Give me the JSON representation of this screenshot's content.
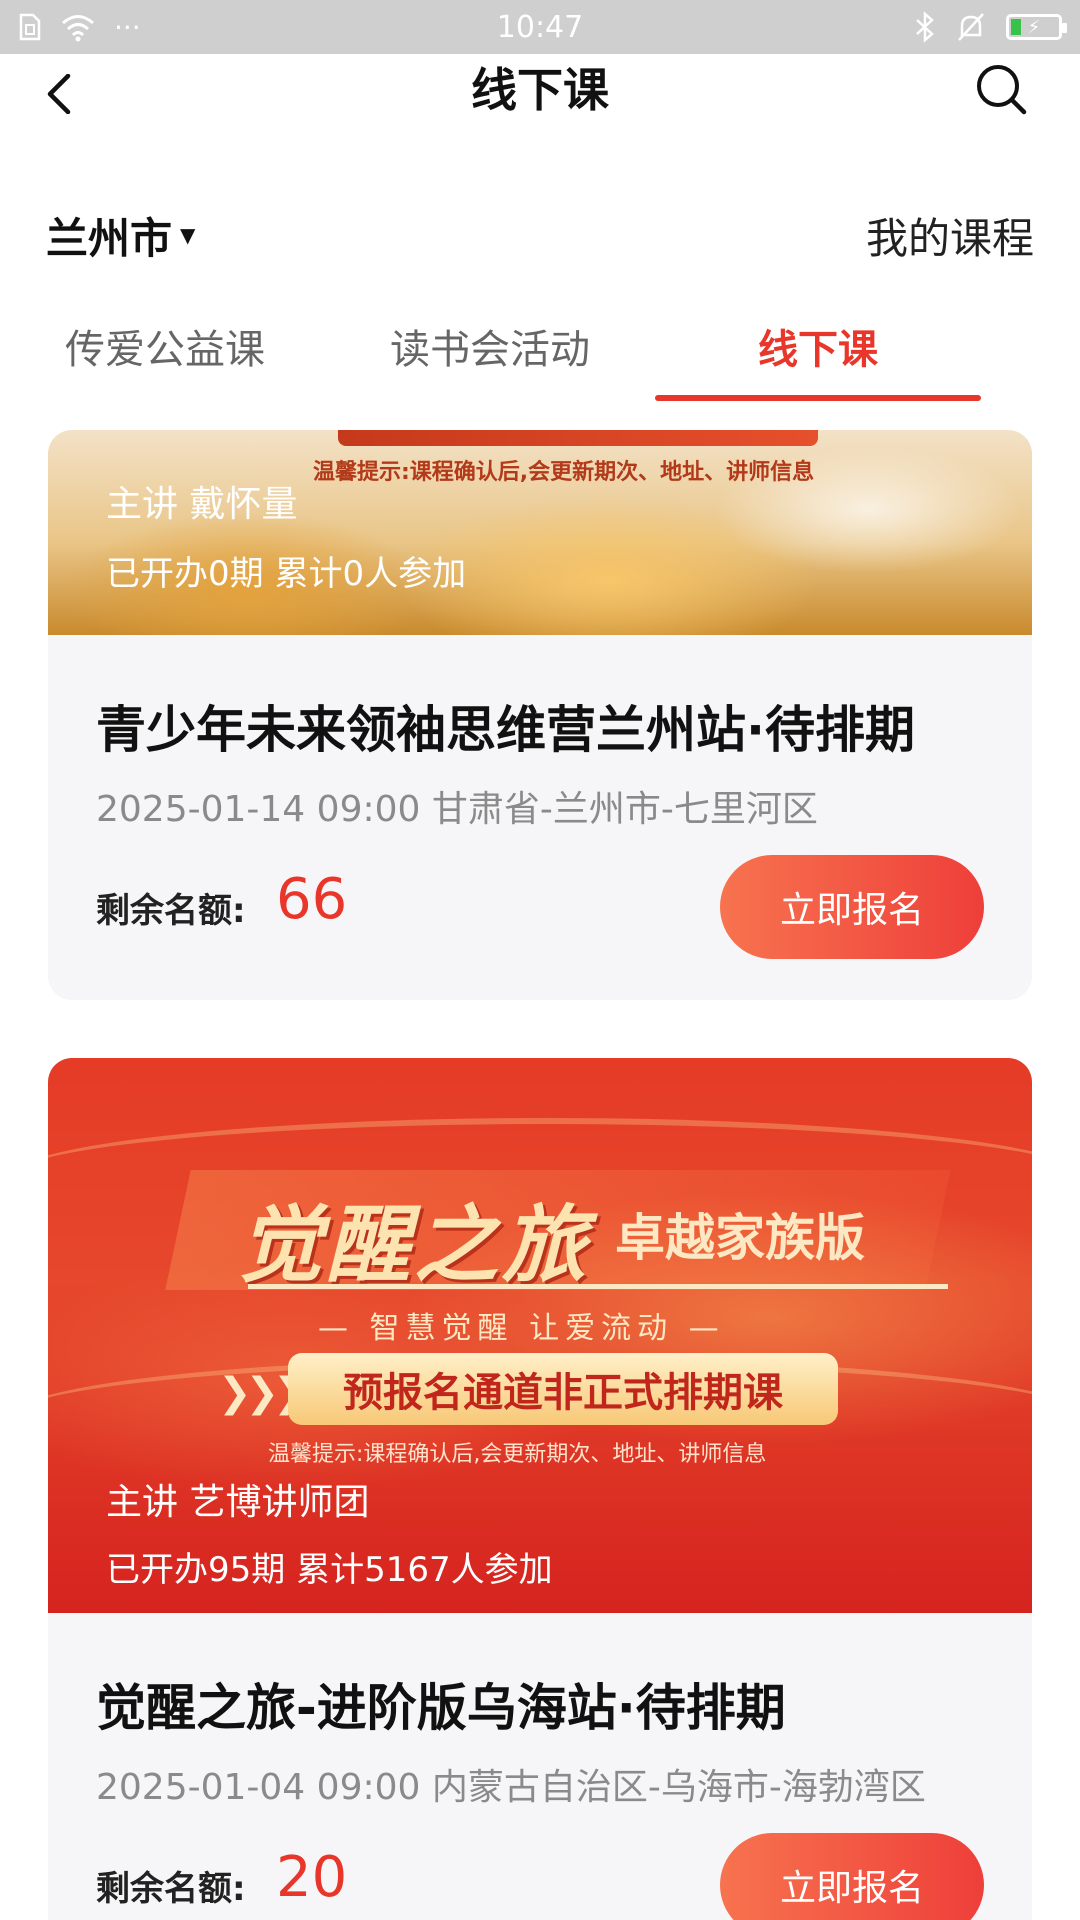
{
  "status_bar": {
    "time": "10:47",
    "left_dots": "···"
  },
  "header": {
    "title": "线下课"
  },
  "city_row": {
    "city": "兰州市",
    "my_courses": "我的课程"
  },
  "tabs": [
    {
      "label": "传爱公益课",
      "active": false
    },
    {
      "label": "读书会活动",
      "active": false
    },
    {
      "label": "线下课",
      "active": true
    }
  ],
  "courses": [
    {
      "banner": {
        "tip": "温馨提示:课程确认后,会更新期次、地址、讲师信息",
        "speaker": "主讲  戴怀量",
        "stats": "已开办0期   累计0人参加"
      },
      "title": "青少年未来领袖思维营兰州站·待排期",
      "meta": "2025-01-14 09:00 甘肃省-兰州市-七里河区",
      "quota_label": "剩余名额:",
      "quota_value": "66",
      "signup_label": "立即报名"
    },
    {
      "banner": {
        "hero_title": "觉醒之旅",
        "hero_edition": "卓越家族版",
        "hero_slogan": "— 智慧觉醒  让爱流动 —",
        "hero_pill": "预报名通道非正式排期课",
        "tip": "温馨提示:课程确认后,会更新期次、地址、讲师信息",
        "speaker": "主讲  艺博讲师团",
        "stats": "已开办95期   累计5167人参加"
      },
      "title": "觉醒之旅-进阶版乌海站·待排期",
      "meta": "2025-01-04 09:00 内蒙古自治区-乌海市-海勃湾区",
      "quota_label": "剩余名额:",
      "quota_value": "20",
      "signup_label": "立即报名"
    }
  ],
  "colors": {
    "accent": "#e8362b",
    "button_start": "#f7734f",
    "button_end": "#ee3f3a",
    "status_bar": "#cfcfcf"
  },
  "icons": [
    "wifi-icon",
    "sim-icon",
    "bluetooth-icon",
    "mute-icon",
    "battery-icon",
    "back-icon",
    "search-icon",
    "caret-down-icon"
  ]
}
